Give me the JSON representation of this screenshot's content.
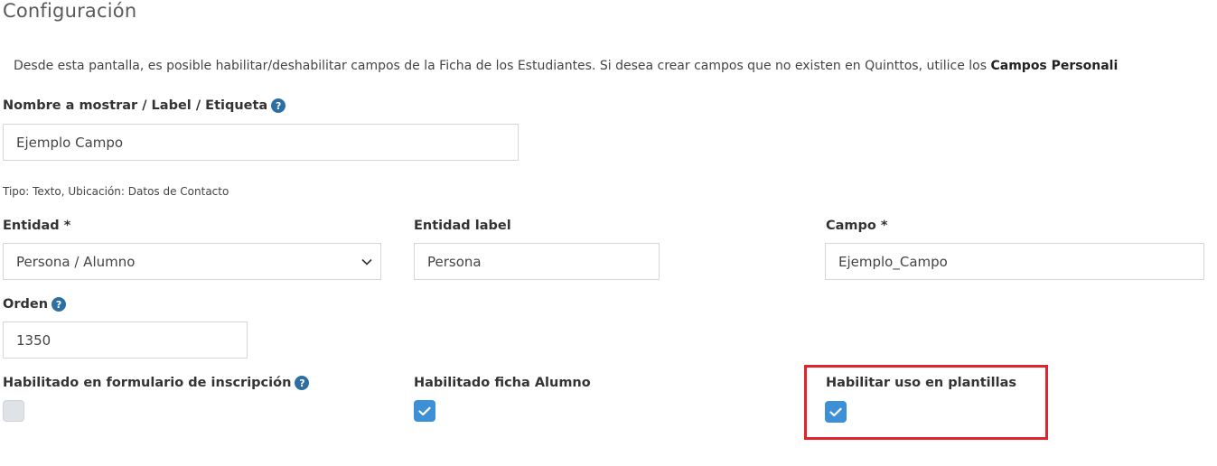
{
  "page": {
    "title": "Configuración",
    "intro_text": "Desde esta pantalla, es posible habilitar/deshabilitar campos de la Ficha de los Estudiantes. Si desea crear campos que no existen en Quinttos, utilice los ",
    "intro_bold": "Campos Personali"
  },
  "form": {
    "nombre": {
      "label": "Nombre a mostrar / Label / Etiqueta",
      "value": "Ejemplo Campo"
    },
    "tipo_hint": "Tipo: Texto, Ubicación: Datos de Contacto",
    "entidad": {
      "label": "Entidad *",
      "value": "Persona / Alumno"
    },
    "entidad_label": {
      "label": "Entidad label",
      "value": "Persona"
    },
    "campo": {
      "label": "Campo *",
      "value": "Ejemplo_Campo"
    },
    "orden": {
      "label": "Orden",
      "value": "1350"
    },
    "hab_inscripcion": {
      "label": "Habilitado en formulario de inscripción",
      "checked": false
    },
    "hab_ficha": {
      "label": "Habilitado ficha Alumno",
      "checked": true
    },
    "hab_plantillas": {
      "label": "Habilitar uso en plantillas",
      "checked": true
    },
    "help_glyph": "?"
  },
  "colors": {
    "help_icon": "#2e6fa3",
    "checkbox_checked": "#3d8fd6",
    "checkbox_disabled": "#dfe3e7",
    "highlight_border": "#e0232d"
  },
  "icons": {
    "help": "question-circle-icon",
    "select_arrow": "chevron-down-icon",
    "check": "checkmark-icon"
  }
}
